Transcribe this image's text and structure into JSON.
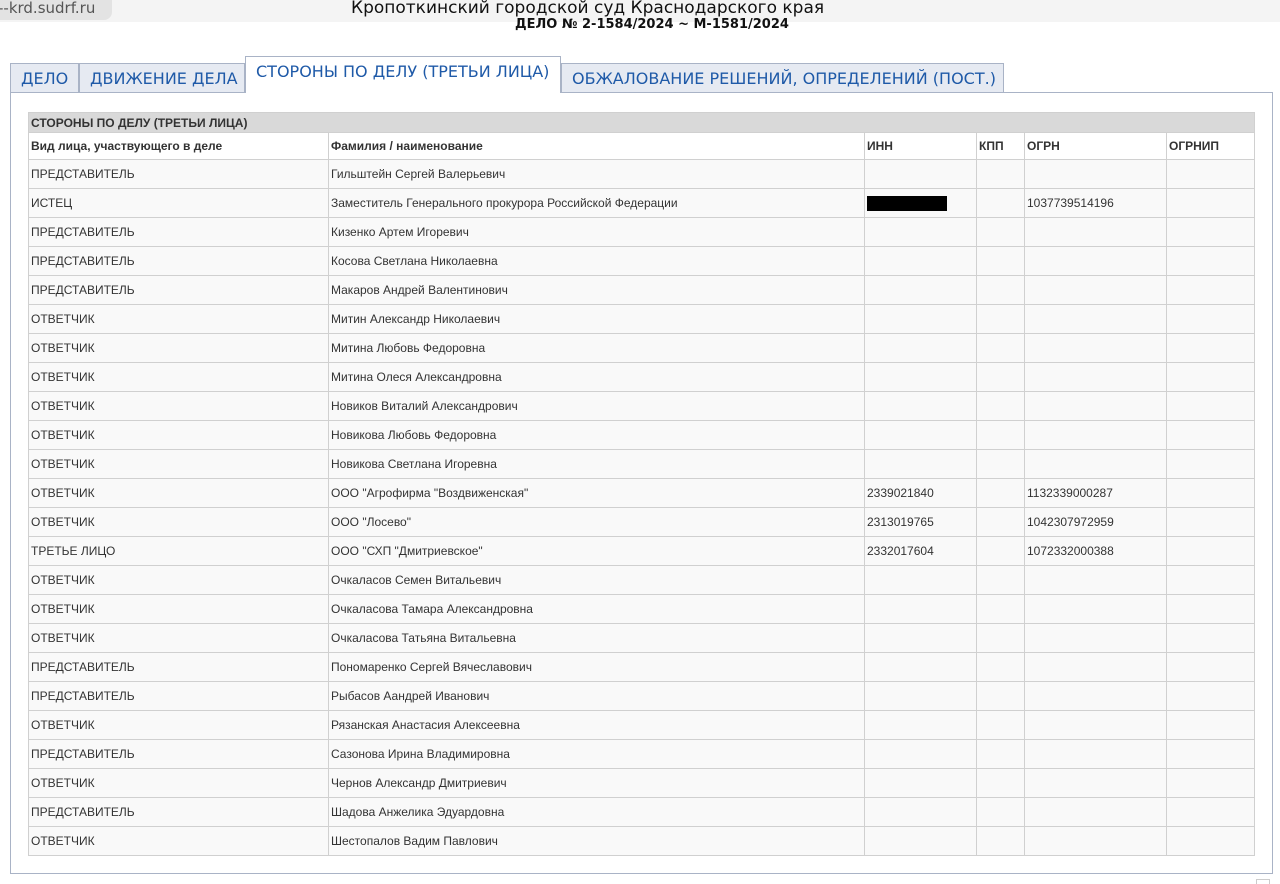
{
  "browser": {
    "url": "--krd.sudrf.ru",
    "title": "Кропоткинский городской суд Краснодарского края"
  },
  "case_number": "ДЕЛО № 2-1584/2024 ~ М-1581/2024",
  "tabs": [
    {
      "label": "ДЕЛО",
      "active": false
    },
    {
      "label": "ДВИЖЕНИЕ ДЕЛА",
      "active": false
    },
    {
      "label": "СТОРОНЫ ПО ДЕЛУ (ТРЕТЬИ ЛИЦА)",
      "active": true
    },
    {
      "label": "ОБЖАЛОВАНИЕ РЕШЕНИЙ, ОПРЕДЕЛЕНИЙ (ПОСТ.)",
      "active": false
    }
  ],
  "table": {
    "section_title": "СТОРОНЫ ПО ДЕЛУ (ТРЕТЬИ ЛИЦА)",
    "columns": [
      "Вид лица, участвующего в деле",
      "Фамилия / наименование",
      "ИНН",
      "КПП",
      "ОГРН",
      "ОГРНИП"
    ],
    "rows": [
      {
        "role": "ПРЕДСТАВИТЕЛЬ",
        "name": "Гильштейн Сергей Валерьевич",
        "inn": "",
        "kpp": "",
        "ogrn": "",
        "ogrnip": ""
      },
      {
        "role": "ИСТЕЦ",
        "name": "Заместитель Генерального прокурора Российской Федерации",
        "inn": "",
        "inn_redacted": true,
        "kpp": "",
        "ogrn": "1037739514196",
        "ogrnip": ""
      },
      {
        "role": "ПРЕДСТАВИТЕЛЬ",
        "name": "Кизенко Артем Игоревич",
        "inn": "",
        "kpp": "",
        "ogrn": "",
        "ogrnip": ""
      },
      {
        "role": "ПРЕДСТАВИТЕЛЬ",
        "name": "Косова Светлана Николаевна",
        "inn": "",
        "kpp": "",
        "ogrn": "",
        "ogrnip": ""
      },
      {
        "role": "ПРЕДСТАВИТЕЛЬ",
        "name": "Макаров Андрей Валентинович",
        "inn": "",
        "kpp": "",
        "ogrn": "",
        "ogrnip": ""
      },
      {
        "role": "ОТВЕТЧИК",
        "name": "Митин Александр Николаевич",
        "inn": "",
        "kpp": "",
        "ogrn": "",
        "ogrnip": ""
      },
      {
        "role": "ОТВЕТЧИК",
        "name": "Митина Любовь Федоровна",
        "inn": "",
        "kpp": "",
        "ogrn": "",
        "ogrnip": ""
      },
      {
        "role": "ОТВЕТЧИК",
        "name": "Митина Олеся Александровна",
        "inn": "",
        "kpp": "",
        "ogrn": "",
        "ogrnip": ""
      },
      {
        "role": "ОТВЕТЧИК",
        "name": "Новиков Виталий Александрович",
        "inn": "",
        "kpp": "",
        "ogrn": "",
        "ogrnip": ""
      },
      {
        "role": "ОТВЕТЧИК",
        "name": "Новикова Любовь Федоровна",
        "inn": "",
        "kpp": "",
        "ogrn": "",
        "ogrnip": ""
      },
      {
        "role": "ОТВЕТЧИК",
        "name": "Новикова Светлана Игоревна",
        "inn": "",
        "kpp": "",
        "ogrn": "",
        "ogrnip": ""
      },
      {
        "role": "ОТВЕТЧИК",
        "name": "ООО \"Агрофирма \"Воздвиженская\"",
        "inn": "2339021840",
        "kpp": "",
        "ogrn": "1132339000287",
        "ogrnip": ""
      },
      {
        "role": "ОТВЕТЧИК",
        "name": "ООО \"Лосево\"",
        "inn": "2313019765",
        "kpp": "",
        "ogrn": "1042307972959",
        "ogrnip": ""
      },
      {
        "role": "ТРЕТЬЕ ЛИЦО",
        "name": "ООО \"СХП \"Дмитриевское\"",
        "inn": "2332017604",
        "kpp": "",
        "ogrn": "1072332000388",
        "ogrnip": ""
      },
      {
        "role": "ОТВЕТЧИК",
        "name": "Очкаласов Семен Витальевич",
        "inn": "",
        "kpp": "",
        "ogrn": "",
        "ogrnip": ""
      },
      {
        "role": "ОТВЕТЧИК",
        "name": "Очкаласова Тамара Александровна",
        "inn": "",
        "kpp": "",
        "ogrn": "",
        "ogrnip": ""
      },
      {
        "role": "ОТВЕТЧИК",
        "name": "Очкаласова Татьяна Витальевна",
        "inn": "",
        "kpp": "",
        "ogrn": "",
        "ogrnip": ""
      },
      {
        "role": "ПРЕДСТАВИТЕЛЬ",
        "name": "Пономаренко Сергей Вячеславович",
        "inn": "",
        "kpp": "",
        "ogrn": "",
        "ogrnip": ""
      },
      {
        "role": "ПРЕДСТАВИТЕЛЬ",
        "name": "Рыбасов Аандрей Иванович",
        "inn": "",
        "kpp": "",
        "ogrn": "",
        "ogrnip": ""
      },
      {
        "role": "ОТВЕТЧИК",
        "name": "Рязанская Анастасия Алексеевна",
        "inn": "",
        "kpp": "",
        "ogrn": "",
        "ogrnip": ""
      },
      {
        "role": "ПРЕДСТАВИТЕЛЬ",
        "name": "Сазонова Ирина Владимировна",
        "inn": "",
        "kpp": "",
        "ogrn": "",
        "ogrnip": ""
      },
      {
        "role": "ОТВЕТЧИК",
        "name": "Чернов Александр Дмитриевич",
        "inn": "",
        "kpp": "",
        "ogrn": "",
        "ogrnip": ""
      },
      {
        "role": "ПРЕДСТАВИТЕЛЬ",
        "name": "Шадова Анжелика Эдуардовна",
        "inn": "",
        "kpp": "",
        "ogrn": "",
        "ogrnip": ""
      },
      {
        "role": "ОТВЕТЧИК",
        "name": "Шестопалов Вадим Павлович",
        "inn": "",
        "kpp": "",
        "ogrn": "",
        "ogrnip": ""
      }
    ]
  },
  "colors": {
    "tab_text": "#1f5aa8",
    "tab_bg": "#e6eaf2",
    "section_header_bg": "#d9d9d9",
    "redaction": "#000000"
  }
}
